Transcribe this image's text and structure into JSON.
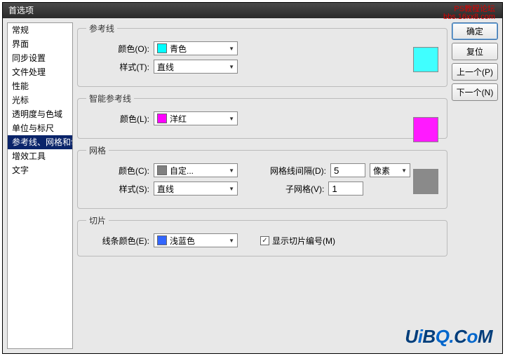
{
  "title": "首选项",
  "watermark": {
    "line1": "PS教程论坛",
    "line2": "bbs.16xx8.com"
  },
  "sidebar": {
    "items": [
      "常规",
      "界面",
      "同步设置",
      "文件处理",
      "性能",
      "光标",
      "透明度与色域",
      "单位与标尺",
      "参考线、网格和切片",
      "增效工具",
      "文字"
    ],
    "selectedIndex": 8
  },
  "buttons": {
    "ok": "确定",
    "reset": "复位",
    "prev": "上一个(P)",
    "next": "下一个(N)"
  },
  "panels": {
    "guides": {
      "legend": "参考线",
      "color_label": "颜色(O):",
      "color_value": "青色",
      "color_swatch": "#00ffff",
      "style_label": "样式(T):",
      "style_value": "直线",
      "big_swatch": "#40ffff"
    },
    "smart": {
      "legend": "智能参考线",
      "color_label": "颜色(L):",
      "color_value": "洋红",
      "color_swatch": "#ff00ff",
      "big_swatch": "#ff1aff"
    },
    "grid": {
      "legend": "网格",
      "color_label": "颜色(C):",
      "color_value": "自定...",
      "color_swatch": "#808080",
      "style_label": "样式(S):",
      "style_value": "直线",
      "gap_label": "网格线间隔(D):",
      "gap_value": "5",
      "gap_unit": "像素",
      "sub_label": "子网格(V):",
      "sub_value": "1",
      "big_swatch": "#8a8a8a"
    },
    "slices": {
      "legend": "切片",
      "color_label": "线条颜色(E):",
      "color_value": "浅蓝色",
      "color_swatch": "#3366ff",
      "show_numbers_checked": true,
      "show_numbers_label": "显示切片编号(M)"
    }
  },
  "logo": {
    "t": "UiBQ.CoM"
  }
}
